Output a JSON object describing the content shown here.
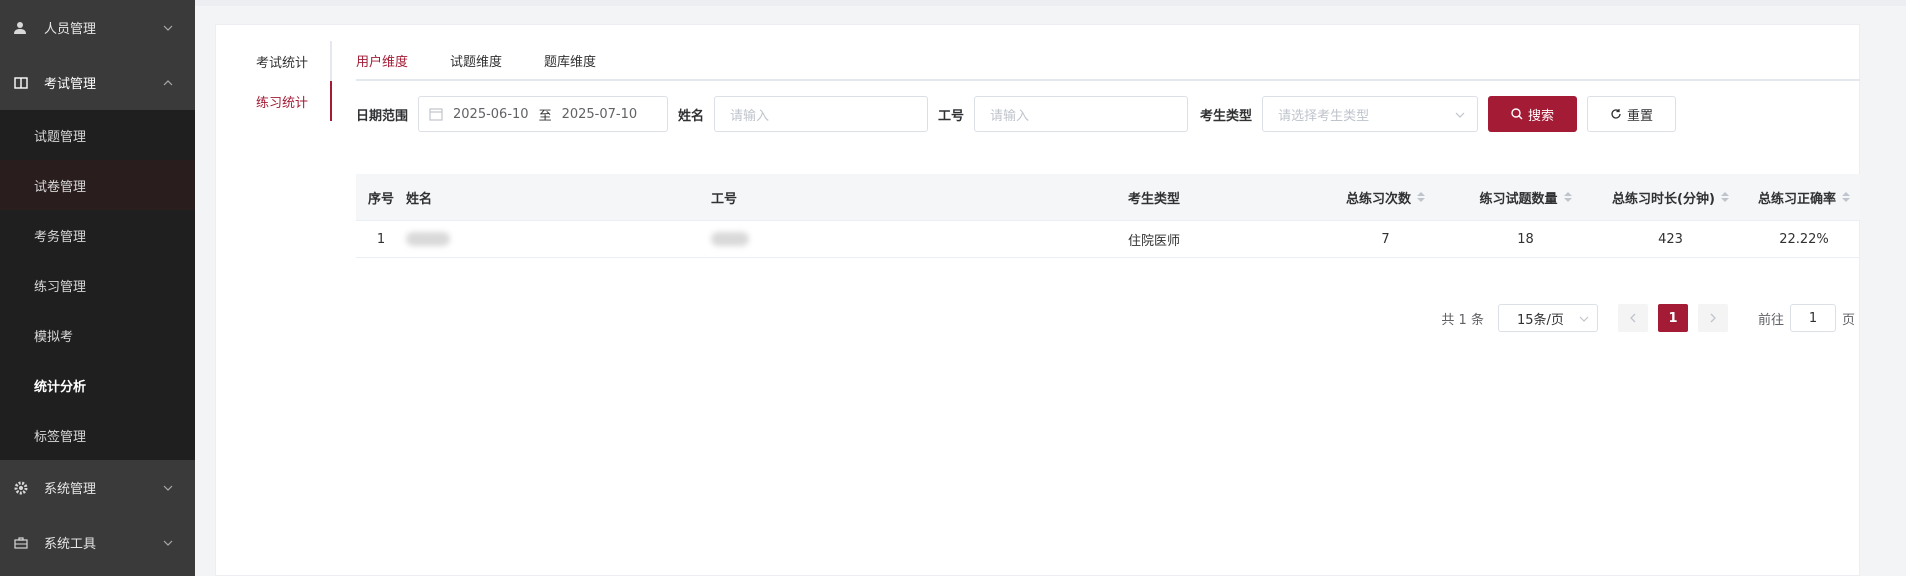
{
  "sidebar": {
    "menu_personnel": "人员管理",
    "menu_exam": "考试管理",
    "exam_items": [
      "试题管理",
      "试卷管理",
      "考务管理",
      "练习管理",
      "模拟考",
      "统计分析",
      "标签管理"
    ],
    "menu_system": "系统管理",
    "menu_tools": "系统工具"
  },
  "left_tabs": [
    "考试统计",
    "练习统计"
  ],
  "top_tabs": [
    "用户维度",
    "试题维度",
    "题库维度"
  ],
  "filters": {
    "date_label": "日期范围",
    "date_start": "2025-06-10",
    "date_sep": "至",
    "date_end": "2025-07-10",
    "name_label": "姓名",
    "name_placeholder": "请输入",
    "id_label": "工号",
    "id_placeholder": "请输入",
    "type_label": "考生类型",
    "type_placeholder": "请选择考生类型",
    "search_label": "搜索",
    "reset_label": "重置"
  },
  "table": {
    "headers": [
      "序号",
      "姓名",
      "工号",
      "考生类型",
      "总练习次数",
      "练习试题数量",
      "总练习时长(分钟)",
      "总练习正确率"
    ],
    "rows": [
      {
        "index": "1",
        "type": "住院医师",
        "count": "7",
        "questions": "18",
        "minutes": "423",
        "accuracy": "22.22%"
      }
    ]
  },
  "pager": {
    "total": "共 1 条",
    "page_size": "15条/页",
    "current": "1",
    "goto_prefix": "前往",
    "goto_value": "1",
    "goto_suffix": "页"
  },
  "colors": {
    "accent": "#a31b35",
    "sidebar_bg": "#3a3a3a",
    "submenu_bg": "#1f1f1f"
  }
}
